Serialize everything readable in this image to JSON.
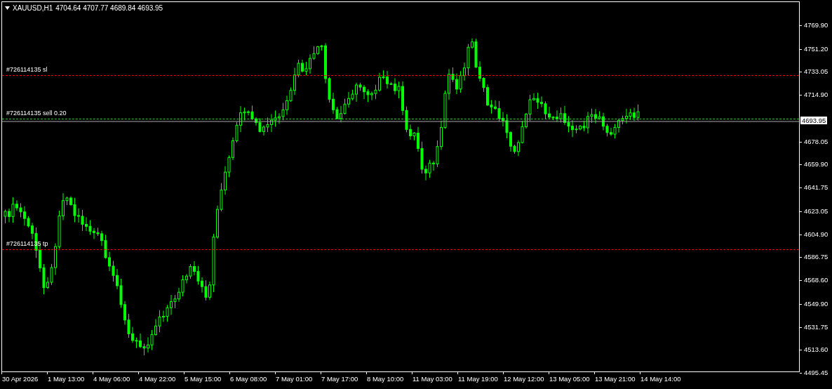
{
  "header": {
    "symbol": "XAUUSD,H1",
    "quote": "4704.64 4707.77 4689.84 4693.95"
  },
  "levels": [
    {
      "kind": "sl",
      "label": "#726114135 sl",
      "color": "#ff0000"
    },
    {
      "kind": "order",
      "label": "#726114135 sell 0.20",
      "color": "#32cd32"
    },
    {
      "kind": "tp",
      "label": "#726114135 tp",
      "color": "#ff0000"
    }
  ],
  "bid": "4693.95",
  "price_axis": [
    "4769.90",
    "4751.20",
    "4733.05",
    "4714.90",
    "4678.05",
    "4659.90",
    "4641.75",
    "4623.05",
    "4604.90",
    "4586.75",
    "4568.60",
    "4549.90",
    "4531.75",
    "4513.60",
    "4495.45"
  ],
  "time_axis": [
    "30 Apr 2026",
    "1 May 13:00",
    "4 May 06:00",
    "4 May 22:00",
    "5 May 15:00",
    "6 May 08:00",
    "7 May 01:00",
    "7 May 17:00",
    "8 May 10:00",
    "11 May 03:00",
    "11 May 19:00",
    "12 May 12:00",
    "13 May 05:00",
    "13 May 21:00",
    "14 May 14:00"
  ]
}
